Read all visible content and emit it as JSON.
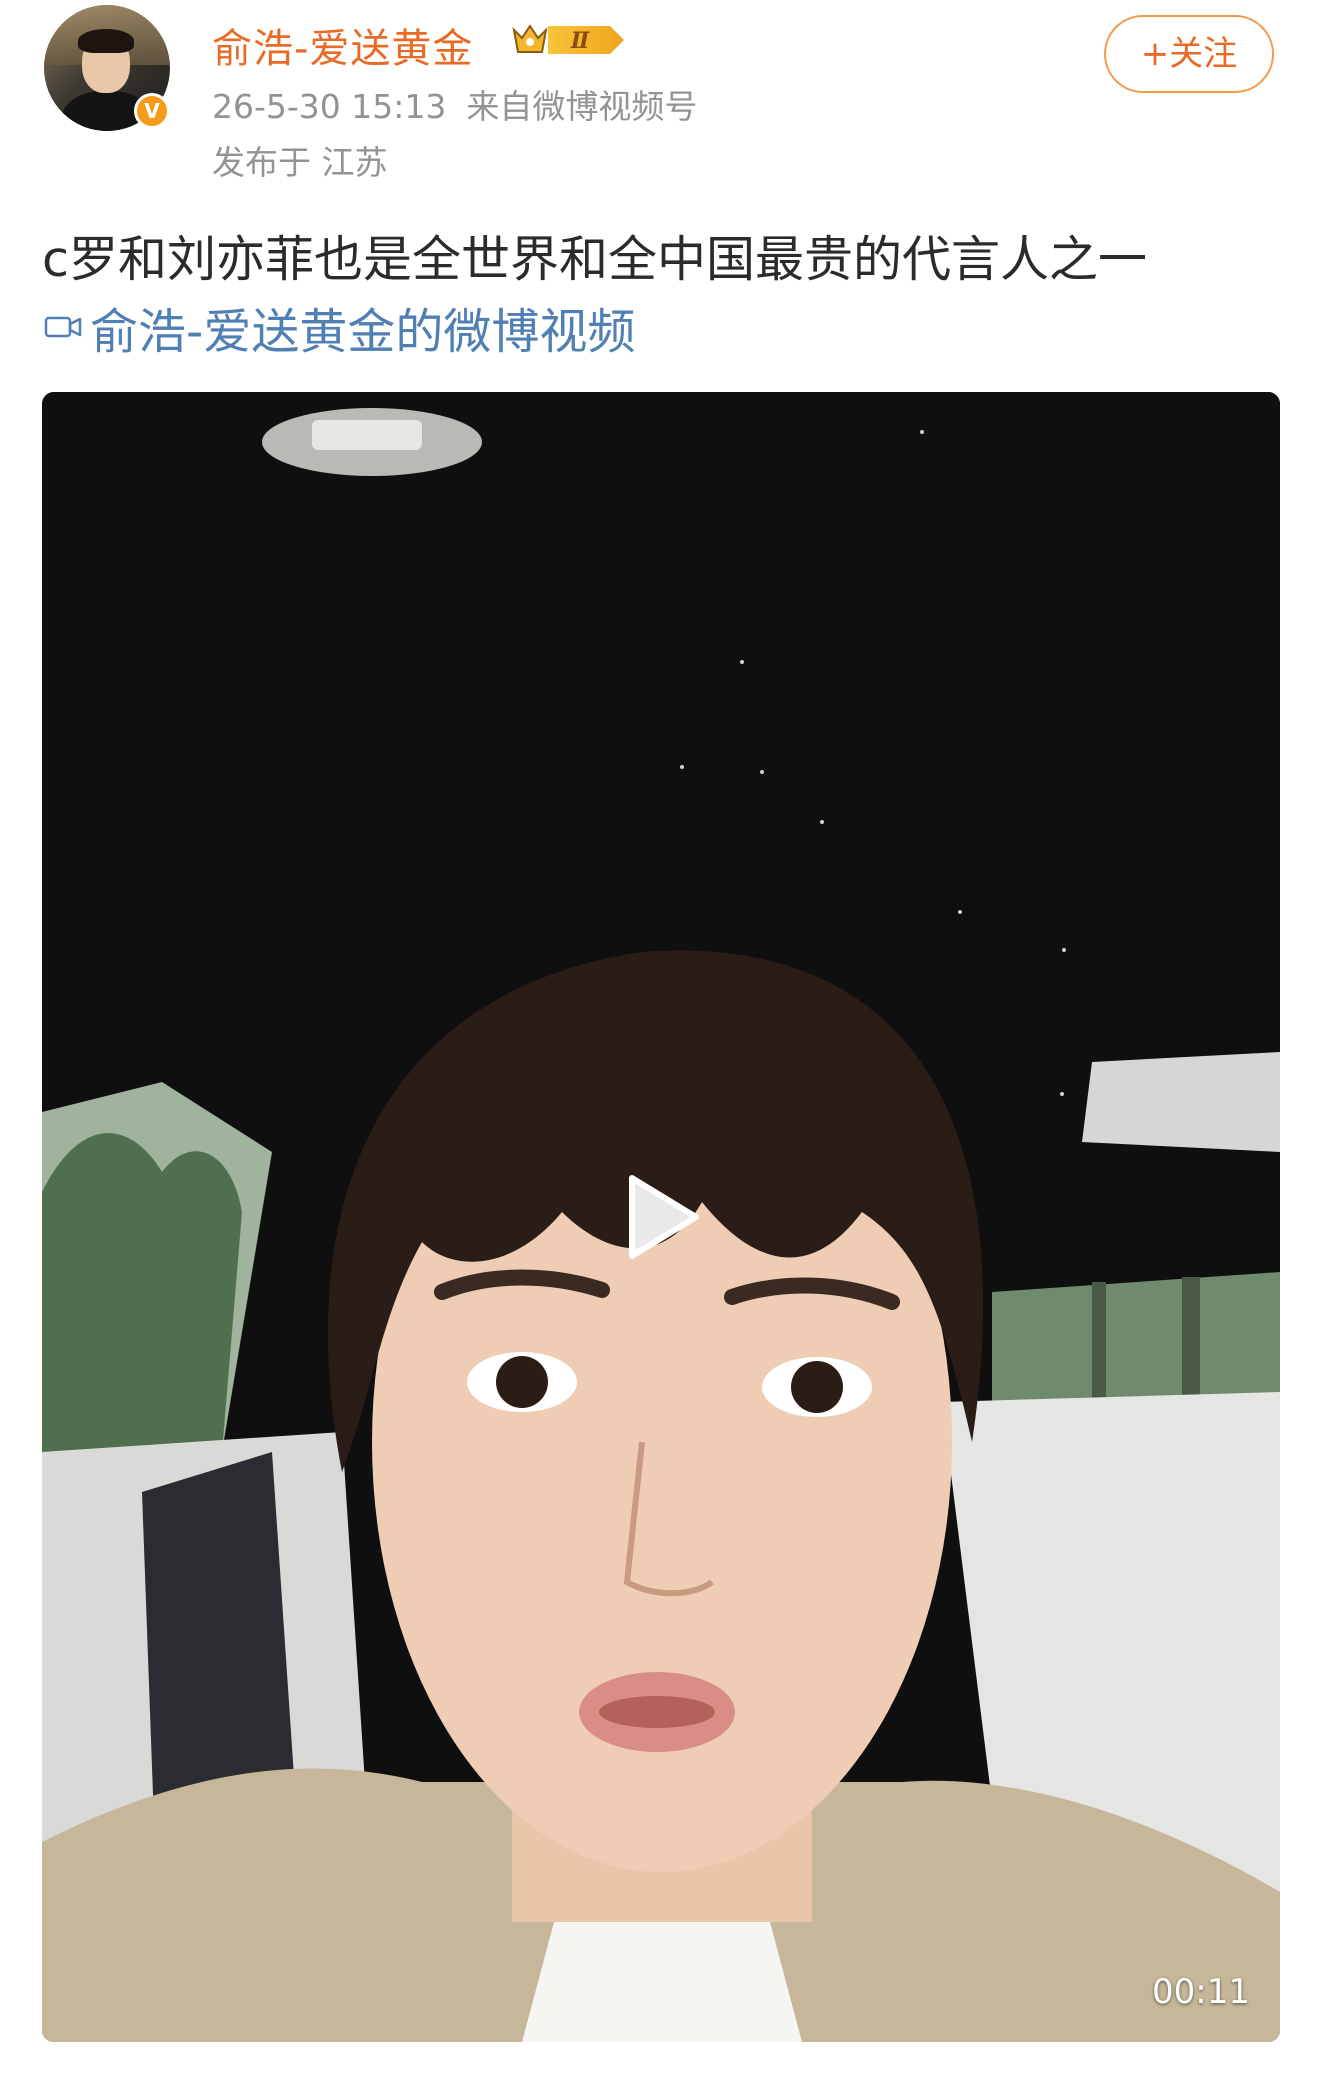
{
  "post": {
    "user_name": "俞浩-爱送黄金",
    "vip_level": "Ⅱ",
    "verified_badge": "V",
    "timestamp": "26-5-30 15:13",
    "source": "来自微博视频号",
    "location": "发布于 江苏",
    "follow_label": "+关注",
    "text": "c罗和刘亦菲也是全世界和全中国最贵的代言人之一",
    "video_link_text": "俞浩-爱送黄金的微博视频",
    "video_duration": "00:11"
  },
  "icons": {
    "avatar": "avatar-icon",
    "vip": "crown-icon",
    "video_link": "video-camera-icon",
    "play": "play-icon"
  },
  "colors": {
    "accent_orange": "#e86a25",
    "meta_gray": "#939393",
    "link_blue": "#4f7fb3"
  }
}
